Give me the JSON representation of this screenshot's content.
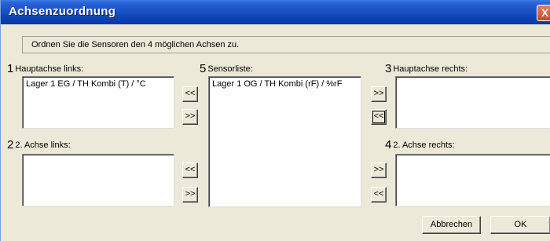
{
  "window": {
    "title": "Achsenzuordnung",
    "close_glyph": "X"
  },
  "info_text": "Ordnen Sie die Sensoren den 4 möglichen Achsen zu.",
  "panels": {
    "left_main": {
      "number": "1",
      "label": "Hauptachse links:",
      "items": [
        "Lager 1 EG / TH Kombi (T) / °C"
      ]
    },
    "left_second": {
      "number": "2",
      "label": "2. Achse links:",
      "items": []
    },
    "sensor_list": {
      "number": "5",
      "label": "Sensorliste:",
      "items": [
        "Lager 1 OG / TH Kombi (rF) / %rF"
      ]
    },
    "right_main": {
      "number": "3",
      "label": "Hauptachse rechts:",
      "items": []
    },
    "right_second": {
      "number": "4",
      "label": "2. Achse rechts:",
      "items": []
    }
  },
  "arrows": {
    "left": "<<",
    "right": ">>"
  },
  "buttons": {
    "cancel": "Abbrechen",
    "ok": "OK"
  }
}
